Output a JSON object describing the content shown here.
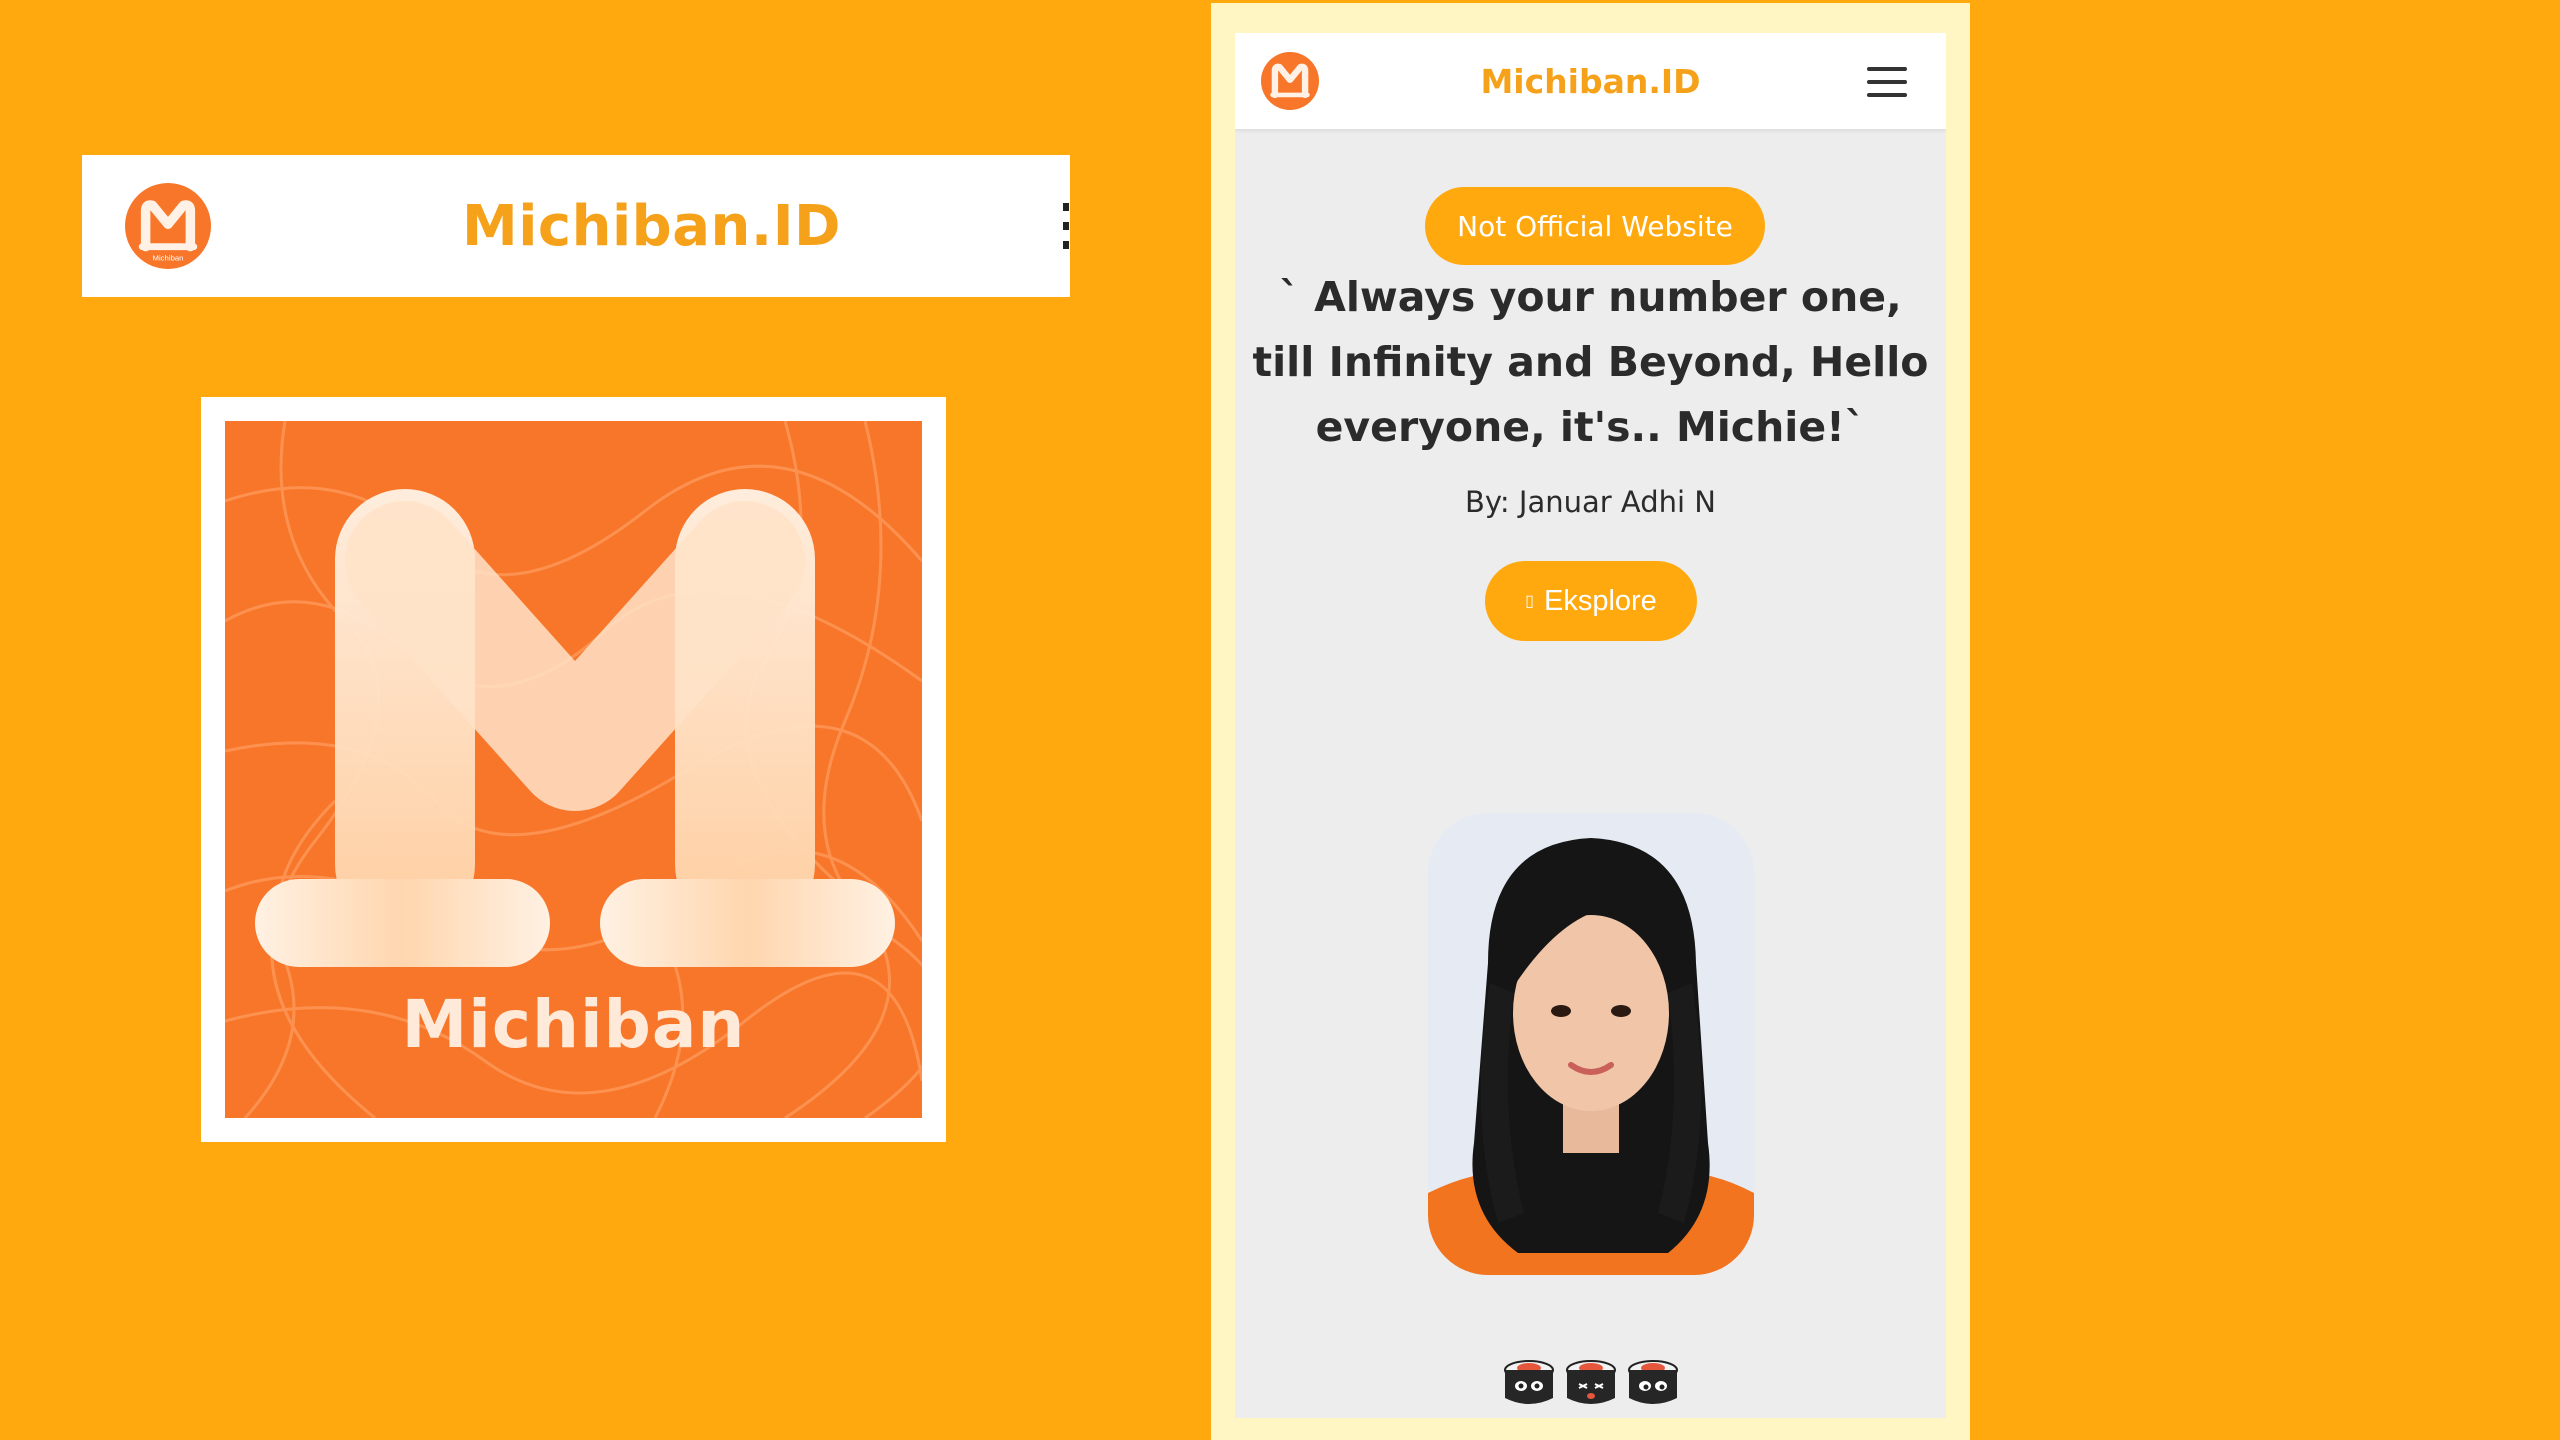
{
  "brand": {
    "name": "Michiban.ID",
    "logo_word": "Michiban",
    "primary_color": "#FFA90F",
    "title_color": "#F6A11A",
    "logo_bg": "#F7762A"
  },
  "desktop_header": {
    "title": "Michiban.ID",
    "logo_icon": "michiban-m-logo-icon",
    "menu_icon": "kebab-menu-icon"
  },
  "logo_card": {
    "word": "Michiban"
  },
  "mobile": {
    "header": {
      "title": "Michiban.ID",
      "menu_icon": "hamburger-menu-icon"
    },
    "badge": "Not Official Website",
    "quote": "` Always your number one, till Infinity and Beyond, Hello everyone, it's.. Michie!`",
    "byline": "By: Januar Adhi N",
    "explore": {
      "icon": "arrow-icon",
      "icon_glyph": "▯",
      "label": "Eksplore"
    },
    "portrait_icon": "member-portrait",
    "footer_icons": [
      "sushi-icon",
      "sushi-icon",
      "sushi-icon"
    ]
  }
}
